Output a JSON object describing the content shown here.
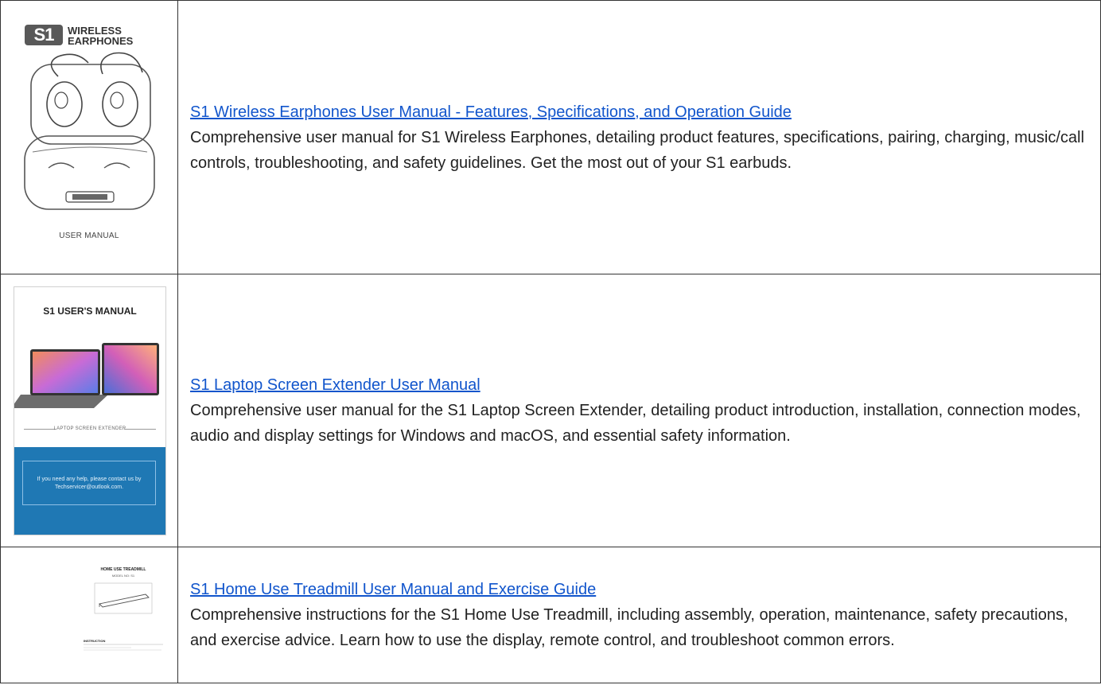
{
  "rows": [
    {
      "thumbnail": {
        "logo_text": "S1",
        "brand_line1": "WIRELESS",
        "brand_line2": "EARPHONES",
        "caption": "USER MANUAL"
      },
      "title": "S1 Wireless Earphones User Manual - Features, Specifications, and Operation Guide",
      "description": "Comprehensive user manual for S1 Wireless Earphones, detailing product features, specifications, pairing, charging, music/call controls, troubleshooting, and safety guidelines. Get the most out of your S1 earbuds."
    },
    {
      "thumbnail": {
        "title": "S1 USER'S MANUAL",
        "subtitle": "LAPTOP SCREEN EXTENDER",
        "help_text": "If you need any help, please contact us by Techservicer@outlook.com."
      },
      "title": "S1 Laptop Screen Extender User Manual",
      "description": "Comprehensive user manual for the S1 Laptop Screen Extender, detailing product introduction, installation, connection modes, audio and display settings for Windows and macOS, and essential safety information."
    },
    {
      "thumbnail": {
        "title": "HOME USE TREADMILL",
        "model": "MODEL NO: S1",
        "section": "INSTRUCTION"
      },
      "title": "S1 Home Use Treadmill User Manual and Exercise Guide",
      "description": "Comprehensive instructions for the S1 Home Use Treadmill, including assembly, operation, maintenance, safety precautions, and exercise advice. Learn how to use the display, remote control, and troubleshoot common errors."
    }
  ],
  "colors": {
    "link": "#1155cc",
    "border": "#333333",
    "blue_panel": "#1f78b4",
    "logo_gray": "#595959"
  }
}
